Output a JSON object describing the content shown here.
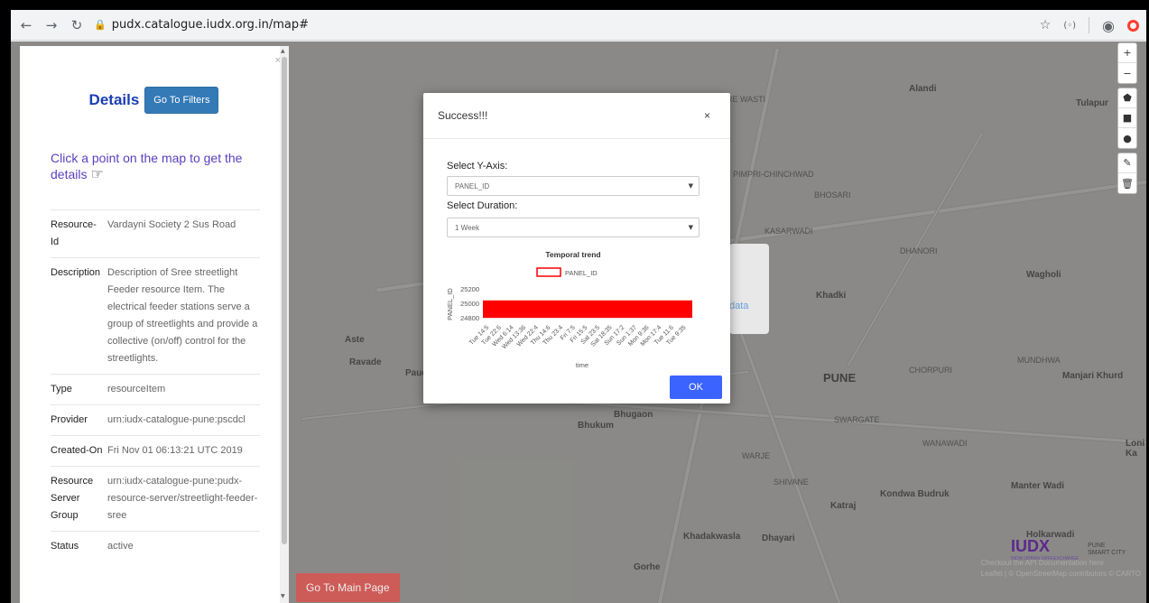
{
  "browser": {
    "url": "pudx.catalogue.iudx.org.in/map#"
  },
  "map": {
    "labels": [
      {
        "text": "Alandi",
        "cls": "town"
      },
      {
        "text": "Tulapur",
        "cls": "town"
      },
      {
        "text": "RE WASTI",
        "cls": ""
      },
      {
        "text": "PIMPRI-CHINCHWAD",
        "cls": ""
      },
      {
        "text": "BHOSARI",
        "cls": ""
      },
      {
        "text": "KASARWADI",
        "cls": ""
      },
      {
        "text": "DHANORI",
        "cls": ""
      },
      {
        "text": "Wagholi",
        "cls": "town"
      },
      {
        "text": "Khadki",
        "cls": "town"
      },
      {
        "text": "MUNDHWA",
        "cls": ""
      },
      {
        "text": "PUNE",
        "cls": "city"
      },
      {
        "text": "CHORPURI",
        "cls": ""
      },
      {
        "text": "Manjari Khurd",
        "cls": "town"
      },
      {
        "text": "SWARGATE",
        "cls": ""
      },
      {
        "text": "WANAWADI",
        "cls": ""
      },
      {
        "text": "Loni Ka",
        "cls": "town"
      },
      {
        "text": "Aste",
        "cls": "town"
      },
      {
        "text": "Ravade",
        "cls": "town"
      },
      {
        "text": "Paud",
        "cls": "town"
      },
      {
        "text": "Pirangut",
        "cls": "town"
      },
      {
        "text": "Bhugaon",
        "cls": "town"
      },
      {
        "text": "Bhukum",
        "cls": "town"
      },
      {
        "text": "WARJE",
        "cls": ""
      },
      {
        "text": "SHIVANE",
        "cls": ""
      },
      {
        "text": "Katraj",
        "cls": "town"
      },
      {
        "text": "Kondwa Budruk",
        "cls": "town"
      },
      {
        "text": "Manter Wadi",
        "cls": "town"
      },
      {
        "text": "Holkarwadi",
        "cls": "town"
      },
      {
        "text": "Khadakwasla",
        "cls": "town"
      },
      {
        "text": "Dhayari",
        "cls": "town"
      },
      {
        "text": "Gorhe",
        "cls": "town"
      }
    ],
    "popup_fragment": "data",
    "attribution": "Leaflet | © OpenStreetMap contributors © CARTO",
    "checkout": "Checkout the API Documentation here"
  },
  "panel": {
    "title": "Details",
    "filters_button": "Go To Filters",
    "close": "×",
    "hint": "Click a point on the map to get the details",
    "rows": [
      {
        "key": "Resource-Id",
        "value": "Vardayni Society 2 Sus Road"
      },
      {
        "key": "Description",
        "value": "Description of Sree streetlight Feeder resource Item. The electrical feeder stations serve a group of streetlights and provide a collective (on/off) control for the streetlights."
      },
      {
        "key": "Type",
        "value": "resourceItem"
      },
      {
        "key": "Provider",
        "value": "urn:iudx-catalogue-pune:pscdcl"
      },
      {
        "key": "Created-On",
        "value": "Fri Nov 01 06:13:21 UTC 2019"
      },
      {
        "key": "Resource Server Group",
        "value": "urn:iudx-catalogue-pune:pudx-resource-server/streetlight-feeder-sree"
      },
      {
        "key": "Status",
        "value": "active"
      }
    ],
    "main_page_button": "Go To Main Page"
  },
  "logos": {
    "iudx": "IUDX",
    "iudx_sub": "INDIA URBAN DATA EXCHANGE",
    "pune_line1": "PUNE",
    "pune_line2": "SMART CITY"
  },
  "modal": {
    "title": "Success!!!",
    "close": "×",
    "y_axis_label": "Select Y-Axis:",
    "y_axis_value": "PANEL_ID",
    "duration_label": "Select Duration:",
    "duration_value": "1 Week",
    "ok_button": "OK"
  },
  "colors": {
    "series": "#ff0000",
    "ok": "#3a63ff",
    "title": "#1a3fb3"
  },
  "chart_data": {
    "type": "area",
    "title": "Temporal trend",
    "xlabel": "time",
    "ylabel": "PANEL_ID",
    "ylim": [
      24740,
      25260
    ],
    "yticks": [
      24800,
      25000,
      25200
    ],
    "series": [
      {
        "name": "PANEL_ID",
        "low": 24800,
        "high": 25040
      }
    ],
    "categories": [
      "Tue 14:5",
      "Tue 22:6",
      "Wed 6:14",
      "Wed 13:36",
      "Wed 22:4",
      "Thu 14:6",
      "Thu 23:4",
      "Fri 7:5",
      "Fri 15:5",
      "Sat 23:5",
      "Sat 18:35",
      "Sun 17:2",
      "Sun 1:37",
      "Mon 9:36",
      "Mon 17:4",
      "Tue 11:6",
      "Tue 9:35"
    ]
  }
}
